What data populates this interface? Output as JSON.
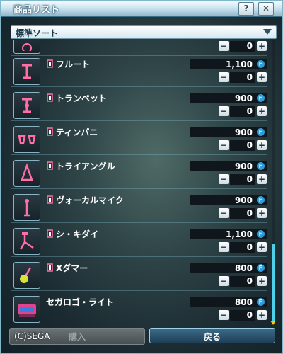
{
  "window": {
    "title": "商品リスト",
    "help_label": "?",
    "close_label": "✕"
  },
  "sort": {
    "label": "標準ソート"
  },
  "items": [
    {
      "name": "",
      "price": "",
      "qty": "0",
      "icon": "partial-item-icon"
    },
    {
      "name": "フルート",
      "price": "1,100",
      "qty": "0",
      "icon": "flute-icon"
    },
    {
      "name": "トランペット",
      "price": "900",
      "qty": "0",
      "icon": "trumpet-icon"
    },
    {
      "name": "ティンパニ",
      "price": "900",
      "qty": "0",
      "icon": "timpani-icon"
    },
    {
      "name": "トライアングル",
      "price": "900",
      "qty": "0",
      "icon": "triangle-icon"
    },
    {
      "name": "ヴォーカルマイク",
      "price": "900",
      "qty": "0",
      "icon": "microphone-icon"
    },
    {
      "name": "シ・キダイ",
      "price": "1,100",
      "qty": "0",
      "icon": "stand-icon"
    },
    {
      "name": "Xダマー",
      "price": "800",
      "qty": "0",
      "icon": "mallet-icon"
    },
    {
      "name": "セガロゴ・ライト",
      "price": "800",
      "qty": "0",
      "icon": "sega-light-icon"
    }
  ],
  "footer": {
    "copyright": "(C)SEGA",
    "buy_label": "購入",
    "back_label": "戻る"
  },
  "currency_symbol": "F",
  "colors": {
    "accent": "#4fd0e8",
    "coin": "#2f9ed8",
    "scroll_arrow": "#f5c800"
  }
}
